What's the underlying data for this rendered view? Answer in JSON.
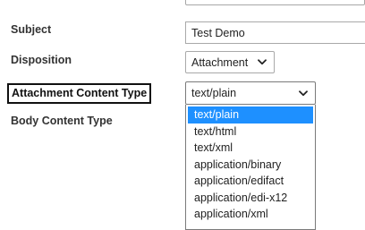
{
  "form": {
    "subject_label": "Subject",
    "subject_value": "Test Demo",
    "disposition_label": "Disposition",
    "disposition_value": "Attachment",
    "attachment_content_type_label": "Attachment Content Type",
    "attachment_content_type_value": "text/plain",
    "body_content_type_label": "Body Content Type"
  },
  "dropdown": {
    "options": [
      "text/plain",
      "text/html",
      "text/xml",
      "application/binary",
      "application/edifact",
      "application/edi-x12",
      "application/xml"
    ],
    "selected_index": 0,
    "highlight_color": "#1e90ff"
  },
  "icons": {
    "select_arrow": "chevron-down-icon"
  }
}
